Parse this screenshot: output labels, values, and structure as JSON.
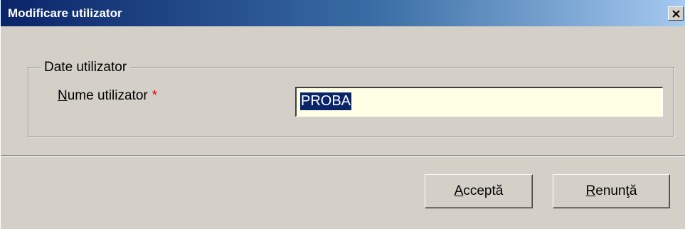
{
  "window": {
    "title": "Modificare utilizator",
    "close_glyph": "×"
  },
  "group": {
    "legend": "Date utilizator"
  },
  "field": {
    "label_mnemonic": "N",
    "label_rest": "ume utilizator",
    "required_mark": "*",
    "value": "PROBA"
  },
  "buttons": {
    "accept_mnemonic": "A",
    "accept_rest": "cceptă",
    "cancel_mnemonic": "R",
    "cancel_rest": "enunţă"
  },
  "colors": {
    "titlebar_start": "#0a246a",
    "titlebar_end": "#a6caf0",
    "face": "#d4d0c8",
    "input_background": "#ffffe6",
    "selection": "#0a246a",
    "required": "#e00000"
  }
}
